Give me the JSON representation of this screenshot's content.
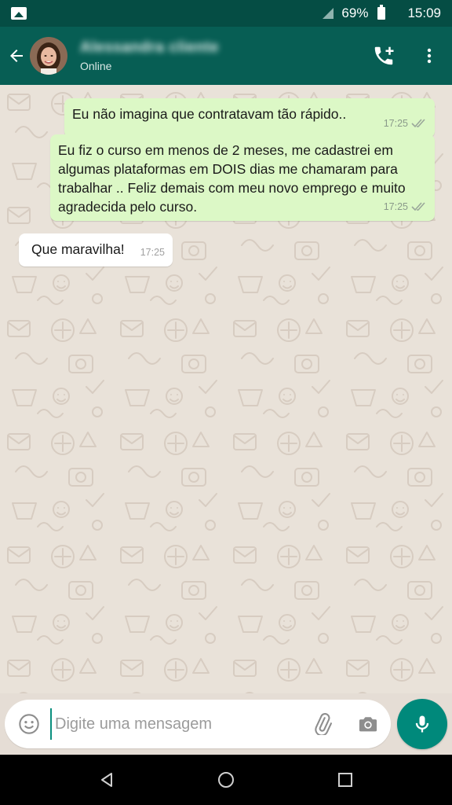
{
  "status_bar": {
    "battery": "69%",
    "time": "15:09",
    "icons": [
      "image-notification-icon",
      "signal-icon",
      "battery-icon"
    ]
  },
  "header": {
    "contact_name": "Alessandra cliente",
    "status": "Online",
    "icons": [
      "back-arrow-icon",
      "add-call-icon",
      "more-vert-icon"
    ]
  },
  "messages": [
    {
      "direction": "out",
      "text": "Eu não imagina que contratavam tão rápido..",
      "time": "17:25",
      "read": true
    },
    {
      "direction": "out",
      "text": "Eu fiz o curso em menos de 2 meses, me cadastrei em algumas plataformas em DOIS dias me chamaram para trabalhar .. Feliz demais com meu novo emprego e muito agradecida pelo curso.",
      "time": "17:25",
      "read": true
    },
    {
      "direction": "in",
      "text": "Que maravilha!",
      "time": "17:25"
    }
  ],
  "composer": {
    "placeholder": "Digite uma mensagem",
    "icons": [
      "emoji-icon",
      "attach-icon",
      "camera-icon",
      "mic-icon"
    ]
  },
  "navigation": {
    "icons": [
      "nav-back-icon",
      "nav-home-icon",
      "nav-recents-icon"
    ]
  },
  "colors": {
    "header": "#075e54",
    "status_bar": "#054d44",
    "outgoing_bubble": "#dcf8c6",
    "incoming_bubble": "#ffffff",
    "accent": "#00897b",
    "read_ticks": "#9aa79a"
  }
}
